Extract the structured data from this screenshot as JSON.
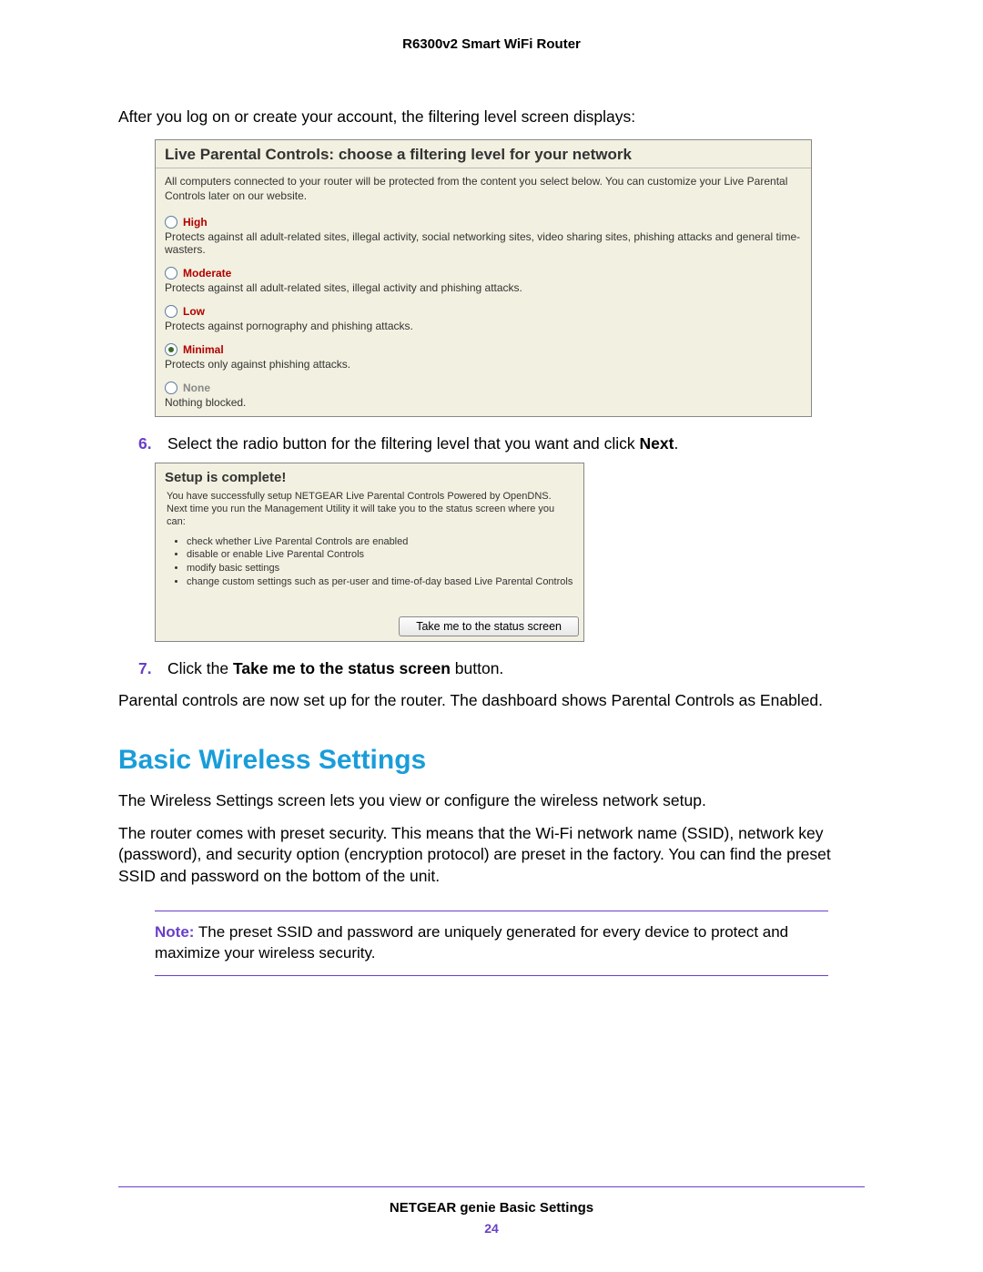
{
  "header": {
    "title": "R6300v2 Smart WiFi Router"
  },
  "intro": "After you log on or create your account, the filtering level screen displays:",
  "panel1": {
    "title": "Live Parental Controls: choose a filtering level for your network",
    "subtitle": "All computers connected to your router will be protected from the content you select below.  You can customize your Live Parental Controls later on our website.",
    "options": [
      {
        "label": "High",
        "desc": "Protects against all adult-related sites, illegal activity, social networking sites, video sharing sites, phishing attacks and general time-wasters.",
        "selected": false,
        "disabled": false
      },
      {
        "label": "Moderate",
        "desc": "Protects against all adult-related sites, illegal activity and phishing attacks.",
        "selected": false,
        "disabled": false
      },
      {
        "label": "Low",
        "desc": "Protects against pornography and phishing attacks.",
        "selected": false,
        "disabled": false
      },
      {
        "label": "Minimal",
        "desc": "Protects only against phishing attacks.",
        "selected": true,
        "disabled": false
      },
      {
        "label": "None",
        "desc": "Nothing blocked.",
        "selected": false,
        "disabled": true
      }
    ]
  },
  "step6": {
    "num": "6.",
    "text_a": "Select the radio button for the filtering level that you want and click ",
    "bold": "Next",
    "text_b": "."
  },
  "panel2": {
    "title": "Setup is complete!",
    "sub": "You have successfully setup NETGEAR Live Parental Controls Powered by OpenDNS.  Next time you run the Management Utility it will take you to the status screen where you can:",
    "bullets": [
      "check whether Live Parental Controls are enabled",
      "disable or enable Live Parental Controls",
      "modify basic settings",
      "change custom settings such as per-user and time-of-day based Live Parental Controls"
    ],
    "button": "Take me to the status screen"
  },
  "step7": {
    "num": "7.",
    "text_a": "Click the ",
    "bold": "Take me to the status screen",
    "text_b": " button."
  },
  "closing": "Parental controls are now set up for the router. The dashboard shows Parental Controls as Enabled.",
  "section": {
    "heading": "Basic Wireless Settings",
    "p1": "The Wireless Settings screen lets you view or configure the wireless network setup.",
    "p2": "The router comes with preset security. This means that the Wi-Fi network name (SSID), network key (password), and security option (encryption protocol) are preset in the factory. You can find the preset SSID and password on the bottom of the unit."
  },
  "note": {
    "label": "Note:",
    "text": " The preset SSID and password are uniquely generated for every device to protect and maximize your wireless security."
  },
  "footer": {
    "title": "NETGEAR genie Basic Settings",
    "page": "24"
  }
}
